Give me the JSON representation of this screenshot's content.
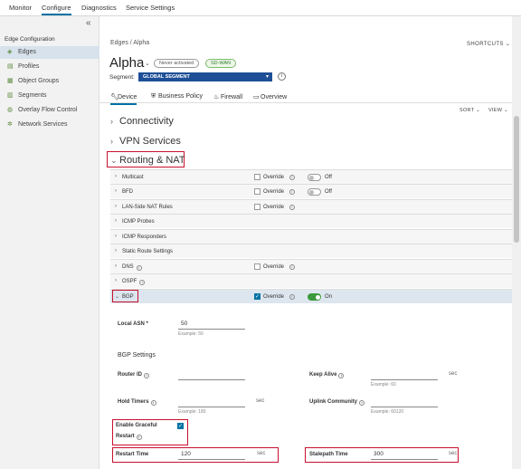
{
  "topnav": {
    "tabs": [
      "Monitor",
      "Configure",
      "Diagnostics",
      "Service Settings"
    ],
    "active": "Configure"
  },
  "sidebar": {
    "collapse_icon": "double-chevron-left-icon",
    "heading": "Edge Configuration",
    "items": [
      {
        "label": "Edges",
        "icon": "edges-icon"
      },
      {
        "label": "Profiles",
        "icon": "profiles-icon"
      },
      {
        "label": "Object Groups",
        "icon": "object-groups-icon"
      },
      {
        "label": "Segments",
        "icon": "segments-icon"
      },
      {
        "label": "Overlay Flow Control",
        "icon": "overlay-icon"
      },
      {
        "label": "Network Services",
        "icon": "network-services-icon"
      }
    ],
    "active": "Edges"
  },
  "header": {
    "breadcrumb": "Edges / Alpha",
    "shortcuts": "SHORTCUTS",
    "title": "Alpha",
    "badge_status": "Never activated",
    "badge_type": "SD-WAN",
    "segment_label": "Segment:",
    "segment_value": "GLOBAL SEGMENT"
  },
  "page_tabs": [
    {
      "label": "Device",
      "icon": "wrench-icon"
    },
    {
      "label": "Business Policy",
      "icon": "shield-icon"
    },
    {
      "label": "Firewall",
      "icon": "flame-icon"
    },
    {
      "label": "Overview",
      "icon": "overview-icon"
    }
  ],
  "active_tab": "Device",
  "sort_label": "SORT",
  "view_label": "VIEW",
  "sections": {
    "connectivity": "Connectivity",
    "vpn": "VPN Services",
    "routing": "Routing & NAT"
  },
  "routing_rows": [
    {
      "label": "Multicast",
      "info": false,
      "override": true,
      "override_checked": false,
      "toggle": true,
      "toggle_on": false,
      "toggle_label": "Off"
    },
    {
      "label": "BFD",
      "info": false,
      "override": true,
      "override_checked": false,
      "toggle": true,
      "toggle_on": false,
      "toggle_label": "Off"
    },
    {
      "label": "LAN-Side NAT Rules",
      "info": false,
      "override": true,
      "override_checked": false,
      "toggle": false
    },
    {
      "label": "ICMP Probes",
      "info": false,
      "override": false,
      "toggle": false
    },
    {
      "label": "ICMP Responders",
      "info": false,
      "override": false,
      "toggle": false
    },
    {
      "label": "Static Route Settings",
      "info": false,
      "override": false,
      "toggle": false
    },
    {
      "label": "DNS",
      "info": true,
      "override": true,
      "override_checked": false,
      "toggle": false
    },
    {
      "label": "OSPF",
      "info": true,
      "override": false,
      "toggle": false
    },
    {
      "label": "BGP",
      "info": false,
      "override": true,
      "override_checked": true,
      "toggle": true,
      "toggle_on": true,
      "toggle_label": "On",
      "expanded": true
    }
  ],
  "override_label": "Override",
  "bgp": {
    "local_asn_label": "Local ASN *",
    "local_asn_value": "50",
    "local_asn_example": "Example: 50",
    "settings_heading": "BGP Settings",
    "router_id_label": "Router ID",
    "keep_alive_label": "Keep Alive",
    "keep_alive_example": "Example: 60",
    "hold_timers_label": "Hold Timers",
    "hold_timers_example": "Example: 180",
    "uplink_community_label": "Uplink Community",
    "uplink_community_example": "Example: 60120",
    "graceful_label_line1": "Enable Graceful",
    "graceful_label_line2": "Restart",
    "graceful_checked": true,
    "restart_time_label": "Restart Time",
    "restart_time_value": "120",
    "stalepath_label": "Stalepath Time",
    "stalepath_value": "300",
    "unit": "sec"
  }
}
